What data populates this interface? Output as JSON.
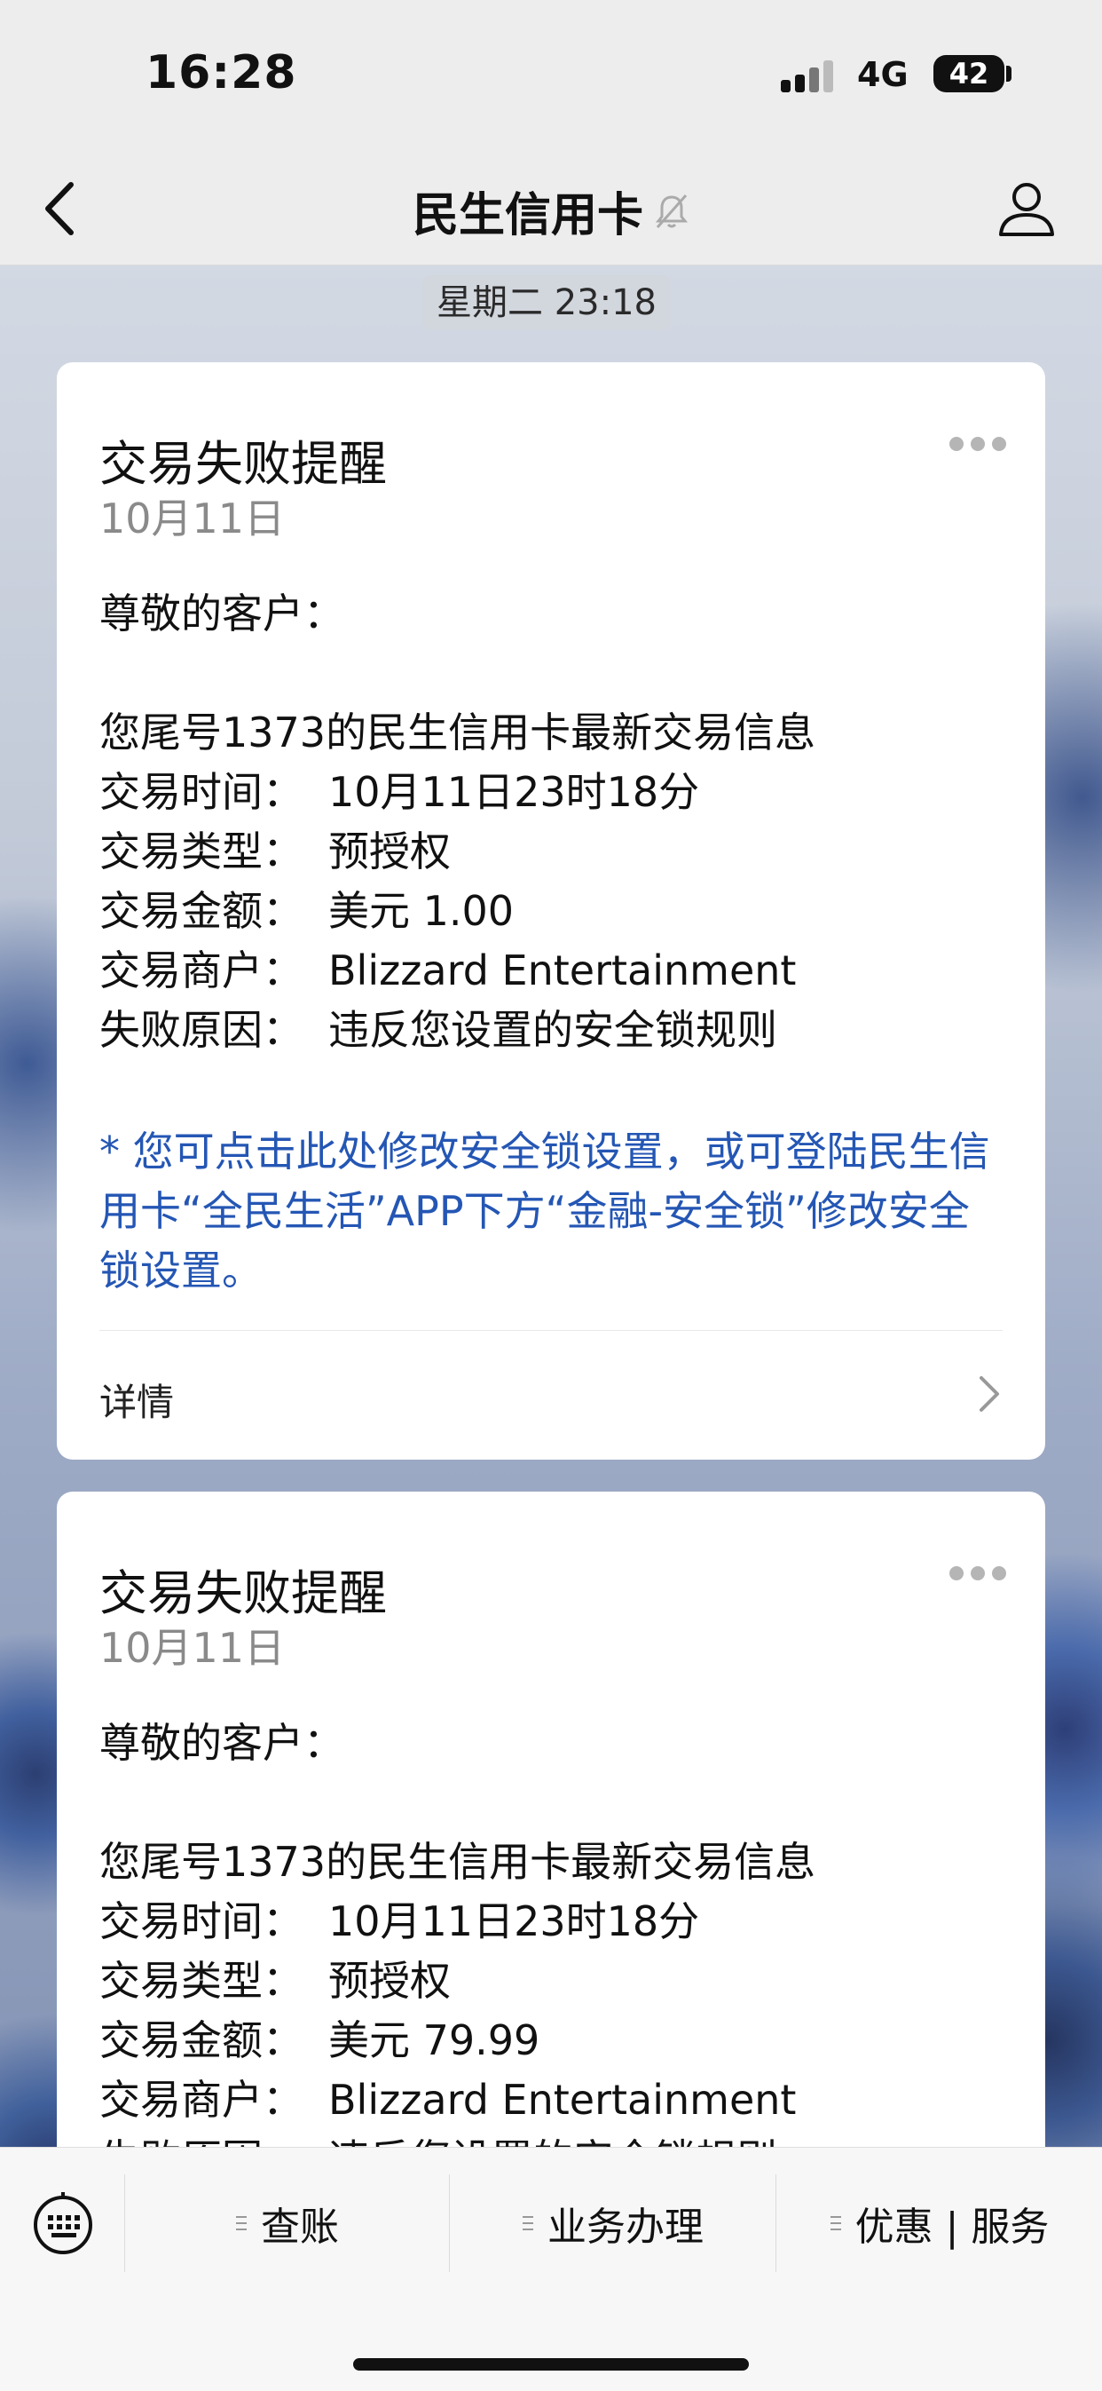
{
  "status_bar": {
    "time": "16:28",
    "network": "4G",
    "battery": "42"
  },
  "nav": {
    "title": "民生信用卡"
  },
  "chat": {
    "timestamp": "星期二 23:18"
  },
  "messages": [
    {
      "title": "交易失败提醒",
      "date": "10月11日",
      "greeting": "尊敬的客户：",
      "intro": "您尾号1373的民生信用卡最新交易信息",
      "fields": [
        {
          "label": "交易时间：",
          "value": "10月11日23时18分"
        },
        {
          "label": "交易类型：",
          "value": "预授权"
        },
        {
          "label": "交易金额：",
          "value": "美元 1.00"
        },
        {
          "label": "交易商户：",
          "value": "Blizzard Entertainment"
        },
        {
          "label": "失败原因：",
          "value": "违反您设置的安全锁规则"
        }
      ],
      "note": "* 您可点击此处修改安全锁设置，或可登陆民生信用卡“全民生活”APP下方“金融-安全锁”修改安全锁设置。",
      "detail_label": "详情"
    },
    {
      "title": "交易失败提醒",
      "date": "10月11日",
      "greeting": "尊敬的客户：",
      "intro": "您尾号1373的民生信用卡最新交易信息",
      "fields": [
        {
          "label": "交易时间：",
          "value": "10月11日23时18分"
        },
        {
          "label": "交易类型：",
          "value": "预授权"
        },
        {
          "label": "交易金额：",
          "value": "美元 79.99"
        },
        {
          "label": "交易商户：",
          "value": "Blizzard Entertainment"
        },
        {
          "label": "失败原因：",
          "value": "违反您设置的安全锁规则"
        }
      ]
    }
  ],
  "bottom_menu": {
    "items": [
      "查账",
      "业务办理",
      "优惠 | 服务"
    ]
  },
  "icons": {
    "back": "chevron-left-icon",
    "bell": "bell-muted-icon",
    "profile": "person-icon",
    "more": "more-dots-icon",
    "detail": "chevron-right-icon",
    "keyboard": "keyboard-icon",
    "menu": "menu-lines-icon"
  },
  "colors": {
    "link": "#2456b4",
    "bar": "#ededed",
    "card": "#ffffff"
  }
}
